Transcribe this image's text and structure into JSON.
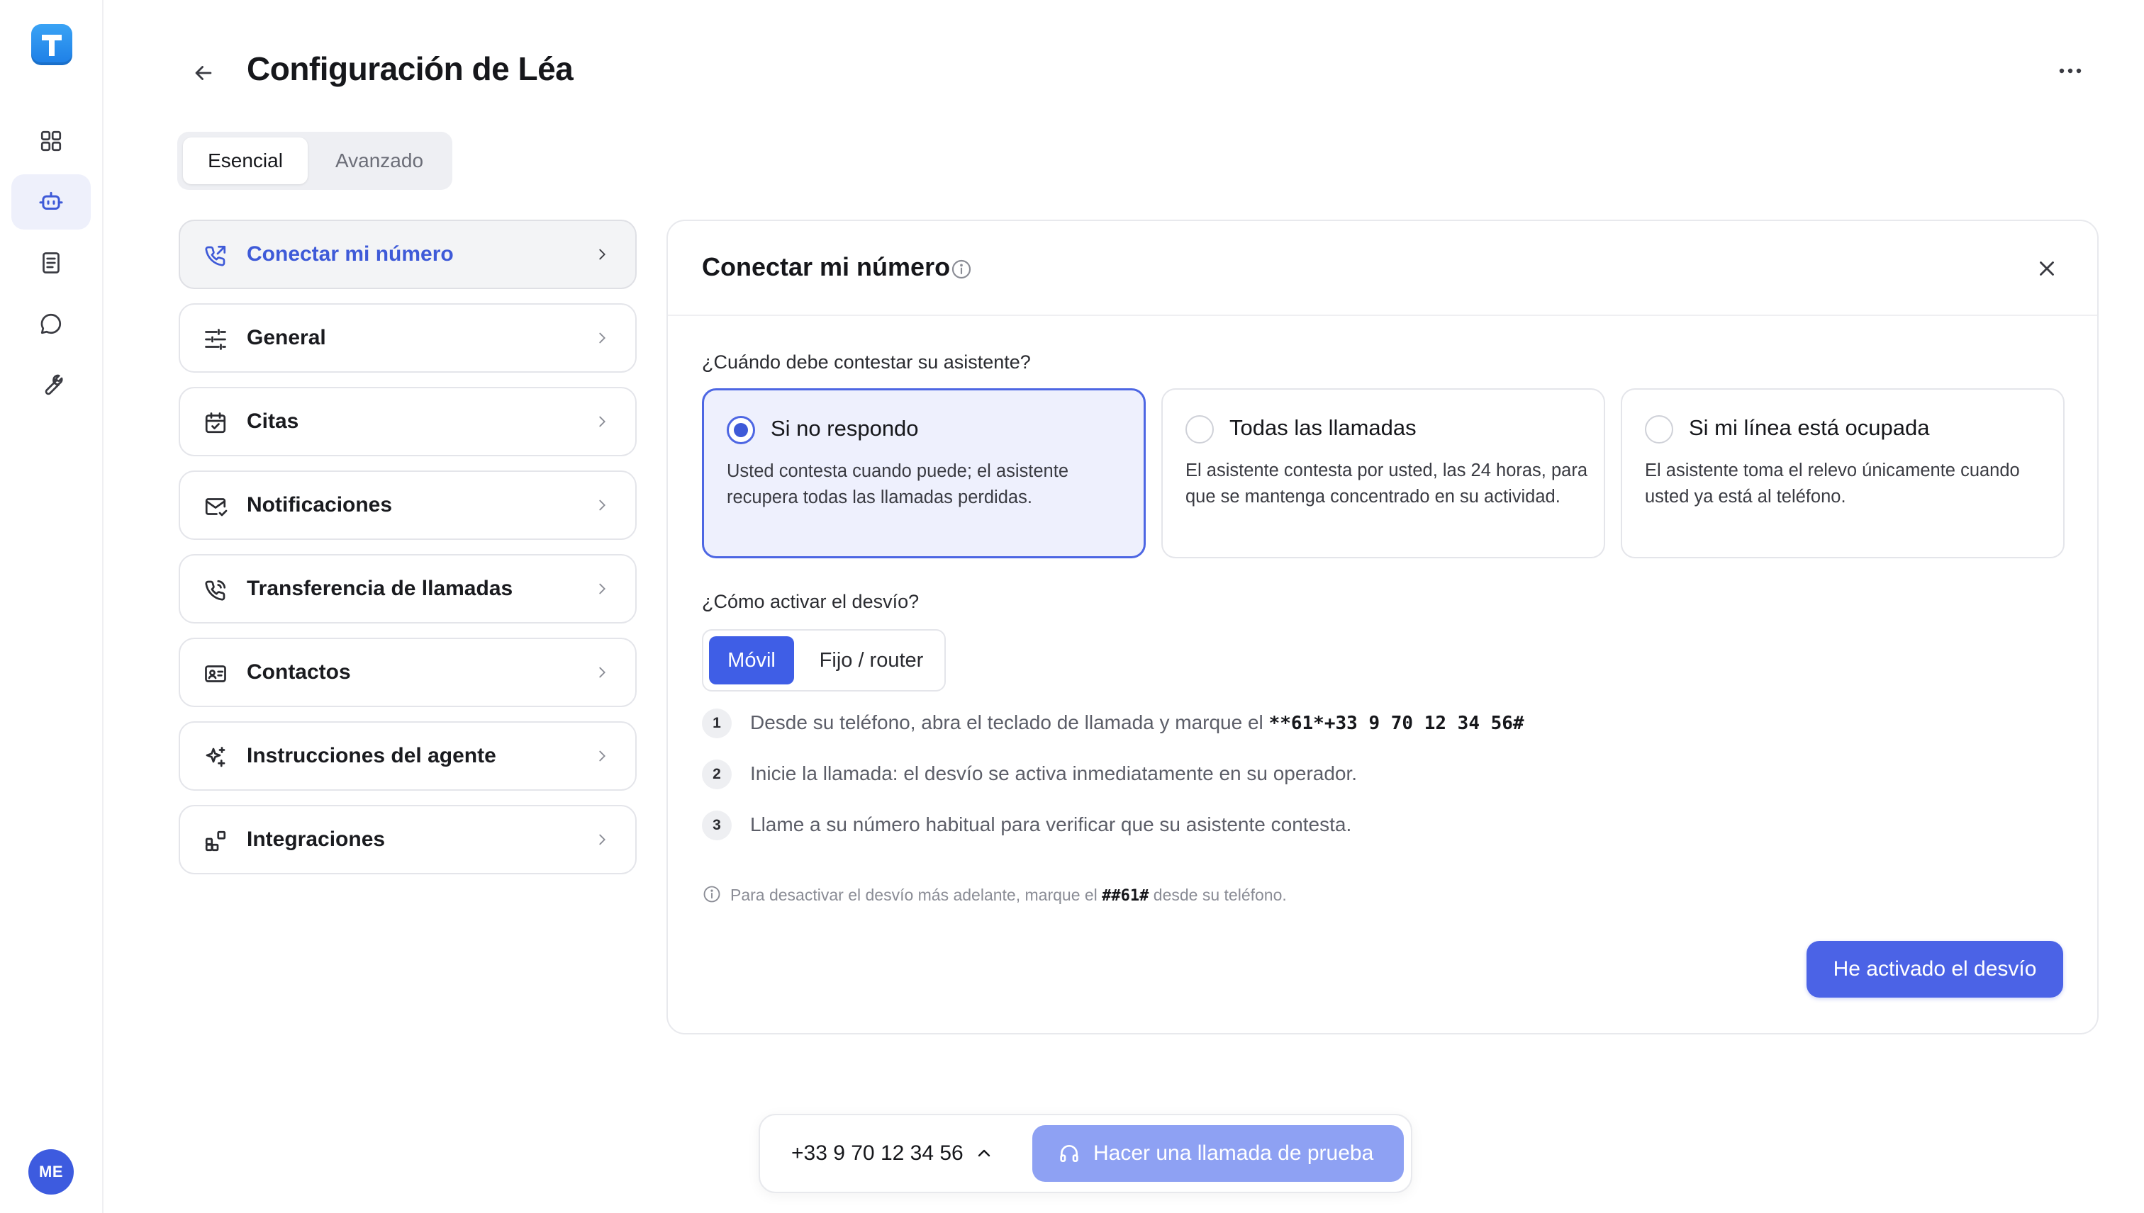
{
  "app": {
    "logo_letter": "T",
    "avatar_initials": "ME"
  },
  "rail": [
    {
      "icon": "grid-icon",
      "active": false
    },
    {
      "icon": "bot-icon",
      "active": true
    },
    {
      "icon": "book-icon",
      "active": false
    },
    {
      "icon": "chat-icon",
      "active": false
    },
    {
      "icon": "wrench-icon",
      "active": false
    }
  ],
  "header": {
    "title": "Configuración de Léa"
  },
  "tabs": [
    {
      "label": "Esencial",
      "active": true
    },
    {
      "label": "Avanzado",
      "active": false
    }
  ],
  "menu": [
    {
      "label": "Conectar mi número",
      "icon": "phone-forward-icon",
      "active": true
    },
    {
      "label": "General",
      "icon": "sliders-icon",
      "active": false
    },
    {
      "label": "Citas",
      "icon": "calendar-icon",
      "active": false
    },
    {
      "label": "Notificaciones",
      "icon": "mail-icon",
      "active": false
    },
    {
      "label": "Transferencia de llamadas",
      "icon": "phone-call-icon",
      "active": false
    },
    {
      "label": "Contactos",
      "icon": "contact-card-icon",
      "active": false
    },
    {
      "label": "Instrucciones del agente",
      "icon": "sparkles-icon",
      "active": false
    },
    {
      "label": "Integraciones",
      "icon": "blocks-icon",
      "active": false
    }
  ],
  "panel": {
    "title": "Conectar mi número",
    "question1": "¿Cuándo debe contestar su asistente?",
    "options": [
      {
        "title": "Si no respondo",
        "desc": "Usted contesta cuando puede; el asistente recupera todas las llamadas perdidas.",
        "selected": true
      },
      {
        "title": "Todas las llamadas",
        "desc": "El asistente contesta por usted, las 24 horas, para que se mantenga concentrado en su actividad.",
        "selected": false
      },
      {
        "title": "Si mi línea está ocupada",
        "desc": "El asistente toma el relevo únicamente cuando usted ya está al teléfono.",
        "selected": false
      }
    ],
    "question2": "¿Cómo activar el desvío?",
    "segments": {
      "a": "Móvil",
      "b": "Fijo / router",
      "selected": "Móvil"
    },
    "steps": [
      {
        "num": "1",
        "text": "Desde su teléfono, abra el teclado de llamada y marque el ",
        "code": "**61*+33 9 70 12 34 56#"
      },
      {
        "num": "2",
        "text": "Inicie la llamada: el desvío se activa inmediatamente en su operador.",
        "code": ""
      },
      {
        "num": "3",
        "text": "Llame a su número habitual para verificar que su asistente contesta.",
        "code": ""
      }
    ],
    "note": {
      "before": "Para desactivar el desvío más adelante, marque el ",
      "code": "##61#",
      "after": " desde su teléfono."
    },
    "primary_button": "He activado el desvío"
  },
  "bottom_bar": {
    "phone": "+33 9 70 12 34 56",
    "test_button": "Hacer una llamada de prueba"
  },
  "colors": {
    "accent": "#3f5ee6",
    "selected_bg": "#eef0fd",
    "test_button": "#8ea1f3",
    "avatar": "#3d5bdf"
  }
}
